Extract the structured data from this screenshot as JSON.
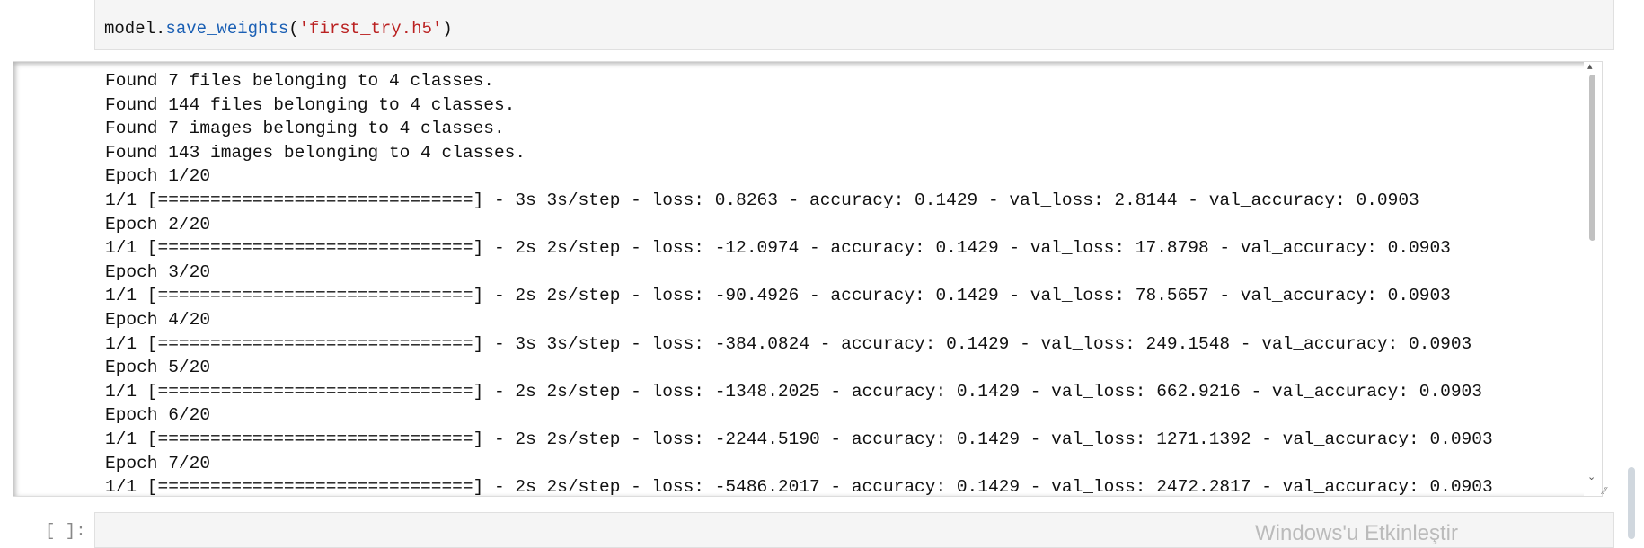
{
  "input_cell": {
    "code_object": "model.",
    "code_function": "save_weights",
    "code_open": "(",
    "code_string": "'first_try.h5'",
    "code_close": ")"
  },
  "output": {
    "lines": [
      "Found 7 files belonging to 4 classes.",
      "Found 144 files belonging to 4 classes.",
      "Found 7 images belonging to 4 classes.",
      "Found 143 images belonging to 4 classes.",
      "Epoch 1/20",
      "1/1 [==============================] - 3s 3s/step - loss: 0.8263 - accuracy: 0.1429 - val_loss: 2.8144 - val_accuracy: 0.0903",
      "Epoch 2/20",
      "1/1 [==============================] - 2s 2s/step - loss: -12.0974 - accuracy: 0.1429 - val_loss: 17.8798 - val_accuracy: 0.0903",
      "Epoch 3/20",
      "1/1 [==============================] - 2s 2s/step - loss: -90.4926 - accuracy: 0.1429 - val_loss: 78.5657 - val_accuracy: 0.0903",
      "Epoch 4/20",
      "1/1 [==============================] - 3s 3s/step - loss: -384.0824 - accuracy: 0.1429 - val_loss: 249.1548 - val_accuracy: 0.0903",
      "Epoch 5/20",
      "1/1 [==============================] - 2s 2s/step - loss: -1348.2025 - accuracy: 0.1429 - val_loss: 662.9216 - val_accuracy: 0.0903",
      "Epoch 6/20",
      "1/1 [==============================] - 2s 2s/step - loss: -2244.5190 - accuracy: 0.1429 - val_loss: 1271.1392 - val_accuracy: 0.0903",
      "Epoch 7/20",
      "1/1 [==============================] - 2s 2s/step - loss: -5486.2017 - accuracy: 0.1429 - val_loss: 2472.2817 - val_accuracy: 0.0903"
    ]
  },
  "next_cell": {
    "prompt": "[ ]:"
  },
  "watermark": "Windows'u Etkinleştir",
  "icons": {
    "scroll_up": "▴",
    "scroll_down": "⌄",
    "resize": "⁄⁄"
  }
}
